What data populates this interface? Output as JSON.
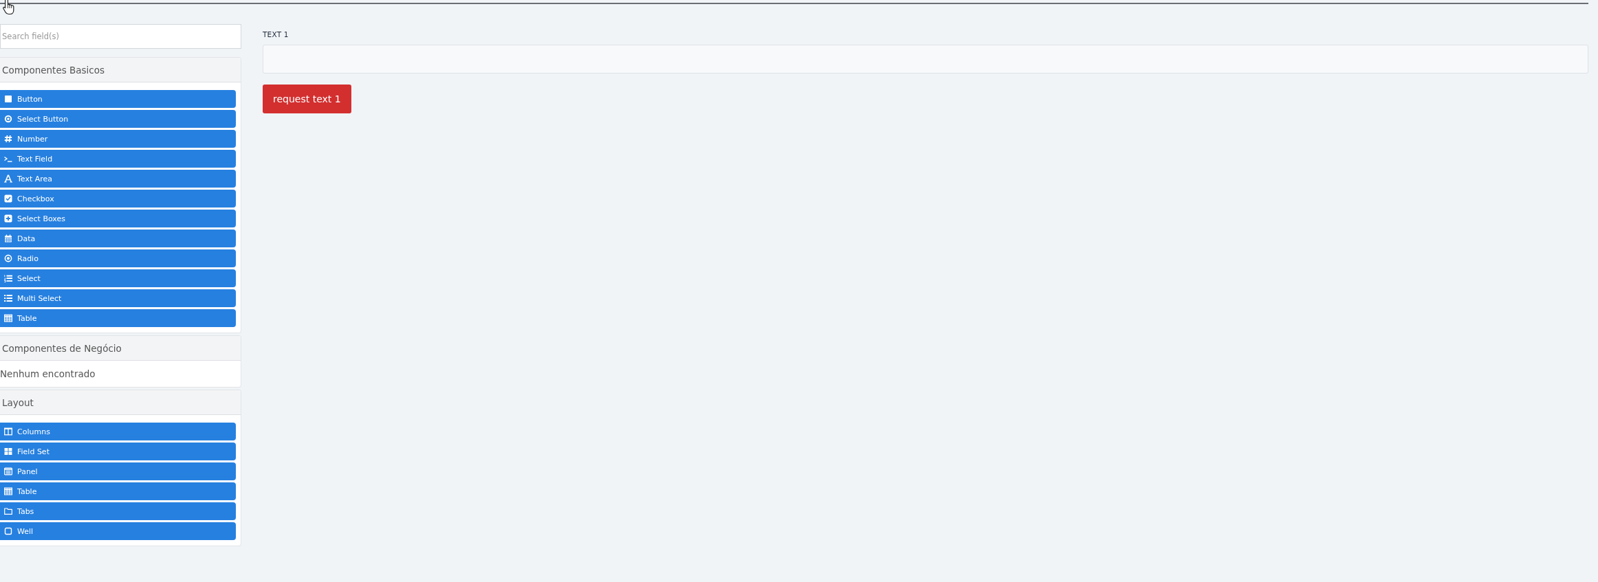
{
  "search": {
    "placeholder": "Search field(s)"
  },
  "sections": [
    {
      "title": "Componentes Basicos",
      "items": [
        {
          "label": "Button",
          "kind": "button"
        },
        {
          "label": "Select Button",
          "kind": "selectbutton"
        },
        {
          "label": "Number",
          "kind": "number"
        },
        {
          "label": "Text Field",
          "kind": "textfield"
        },
        {
          "label": "Text Area",
          "kind": "textarea"
        },
        {
          "label": "Checkbox",
          "kind": "checkbox"
        },
        {
          "label": "Select Boxes",
          "kind": "selectboxes"
        },
        {
          "label": "Data",
          "kind": "date"
        },
        {
          "label": "Radio",
          "kind": "radio"
        },
        {
          "label": "Select",
          "kind": "select"
        },
        {
          "label": "Multi Select",
          "kind": "multiselect"
        },
        {
          "label": "Table",
          "kind": "table"
        }
      ]
    },
    {
      "title": "Componentes de Negócio",
      "empty_message": "Nenhum encontrado"
    },
    {
      "title": "Layout",
      "items": [
        {
          "label": "Columns",
          "kind": "columns"
        },
        {
          "label": "Field Set",
          "kind": "fieldset"
        },
        {
          "label": "Panel",
          "kind": "panel"
        },
        {
          "label": "Table",
          "kind": "table"
        },
        {
          "label": "Tabs",
          "kind": "tabs"
        },
        {
          "label": "Well",
          "kind": "well"
        }
      ]
    }
  ],
  "form": {
    "field": {
      "label": "TEXT 1"
    },
    "button": {
      "label": "request text 1"
    }
  }
}
